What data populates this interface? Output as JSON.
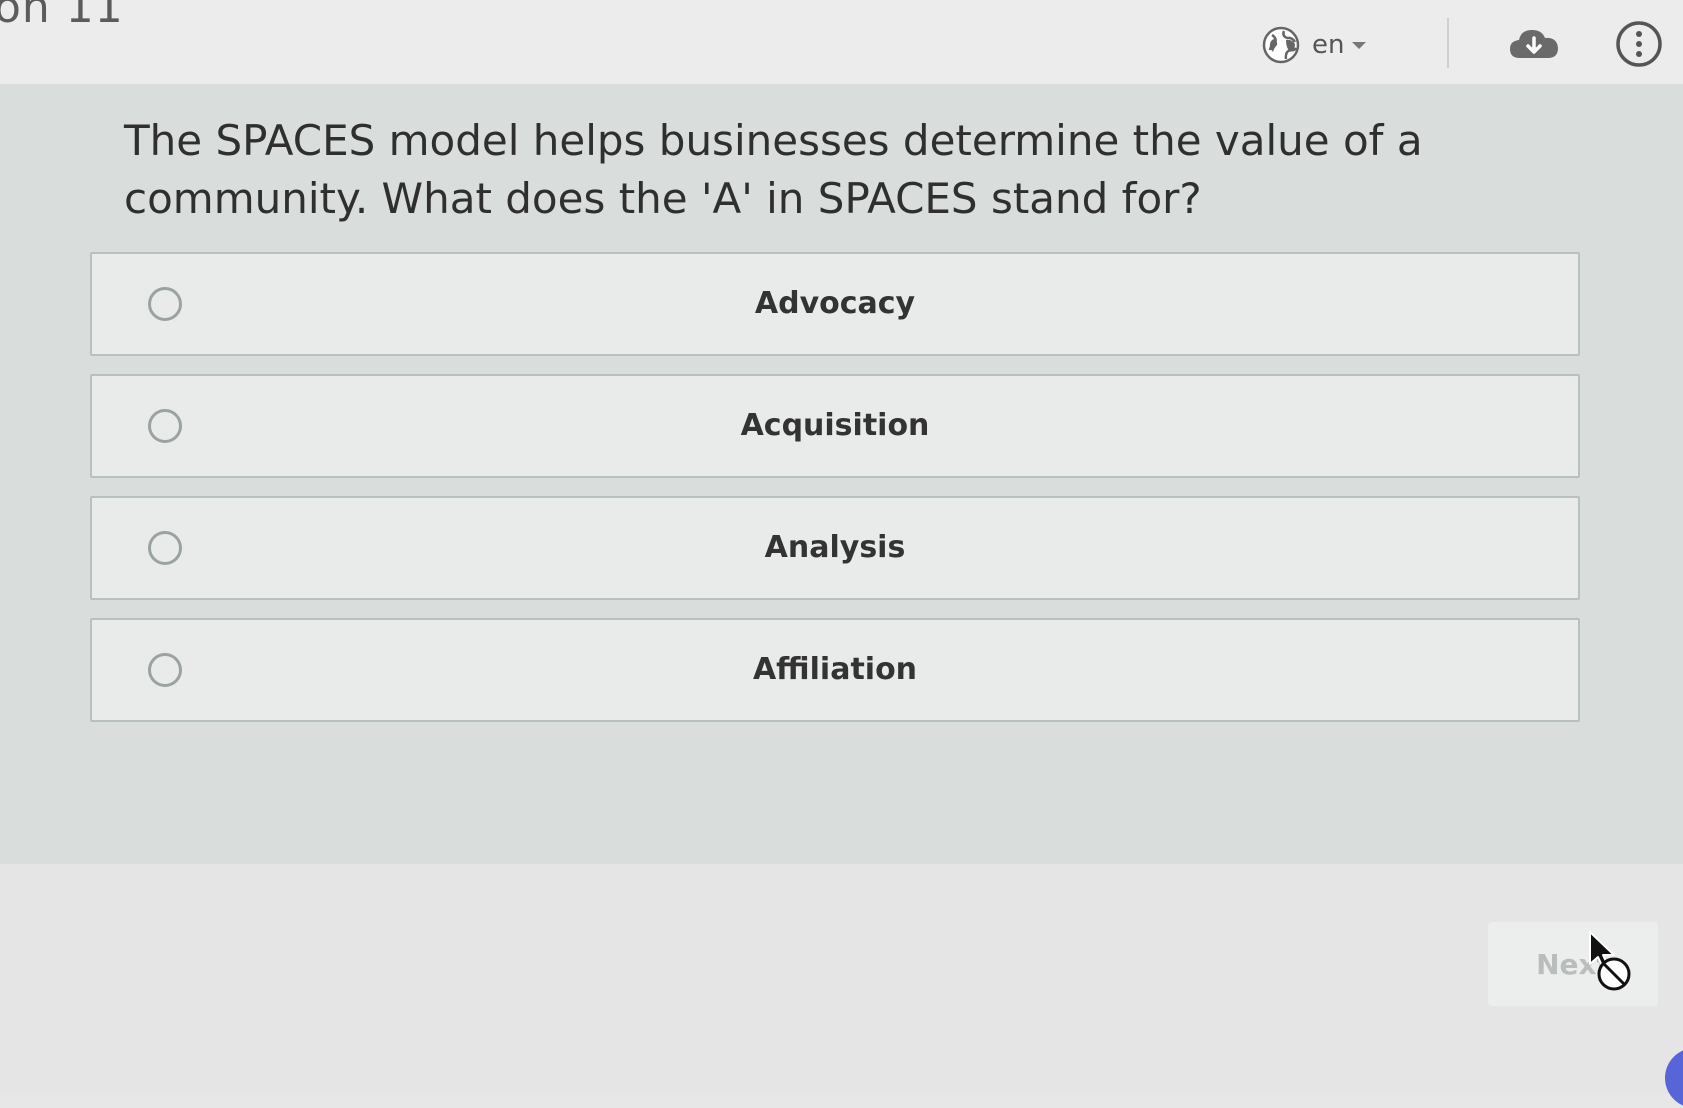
{
  "header": {
    "page_heading": "on 11",
    "language": "en",
    "icons": {
      "globe": "globe-icon",
      "download": "cloud-download-icon",
      "more": "more-options-icon"
    }
  },
  "question": {
    "text": "The SPACES model helps businesses determine the value of a community. What does the 'A' in SPACES stand for?",
    "options": [
      {
        "label": "Advocacy",
        "selected": false
      },
      {
        "label": "Acquisition",
        "selected": false
      },
      {
        "label": "Analysis",
        "selected": false
      },
      {
        "label": "Affiliation",
        "selected": false
      }
    ]
  },
  "footer": {
    "next_label": "Next",
    "next_disabled": true
  },
  "colors": {
    "background": "#e6e7e6",
    "panel": "#d9dddc",
    "option_border": "#b7c2c0",
    "accent_blob": "#5865d8"
  }
}
